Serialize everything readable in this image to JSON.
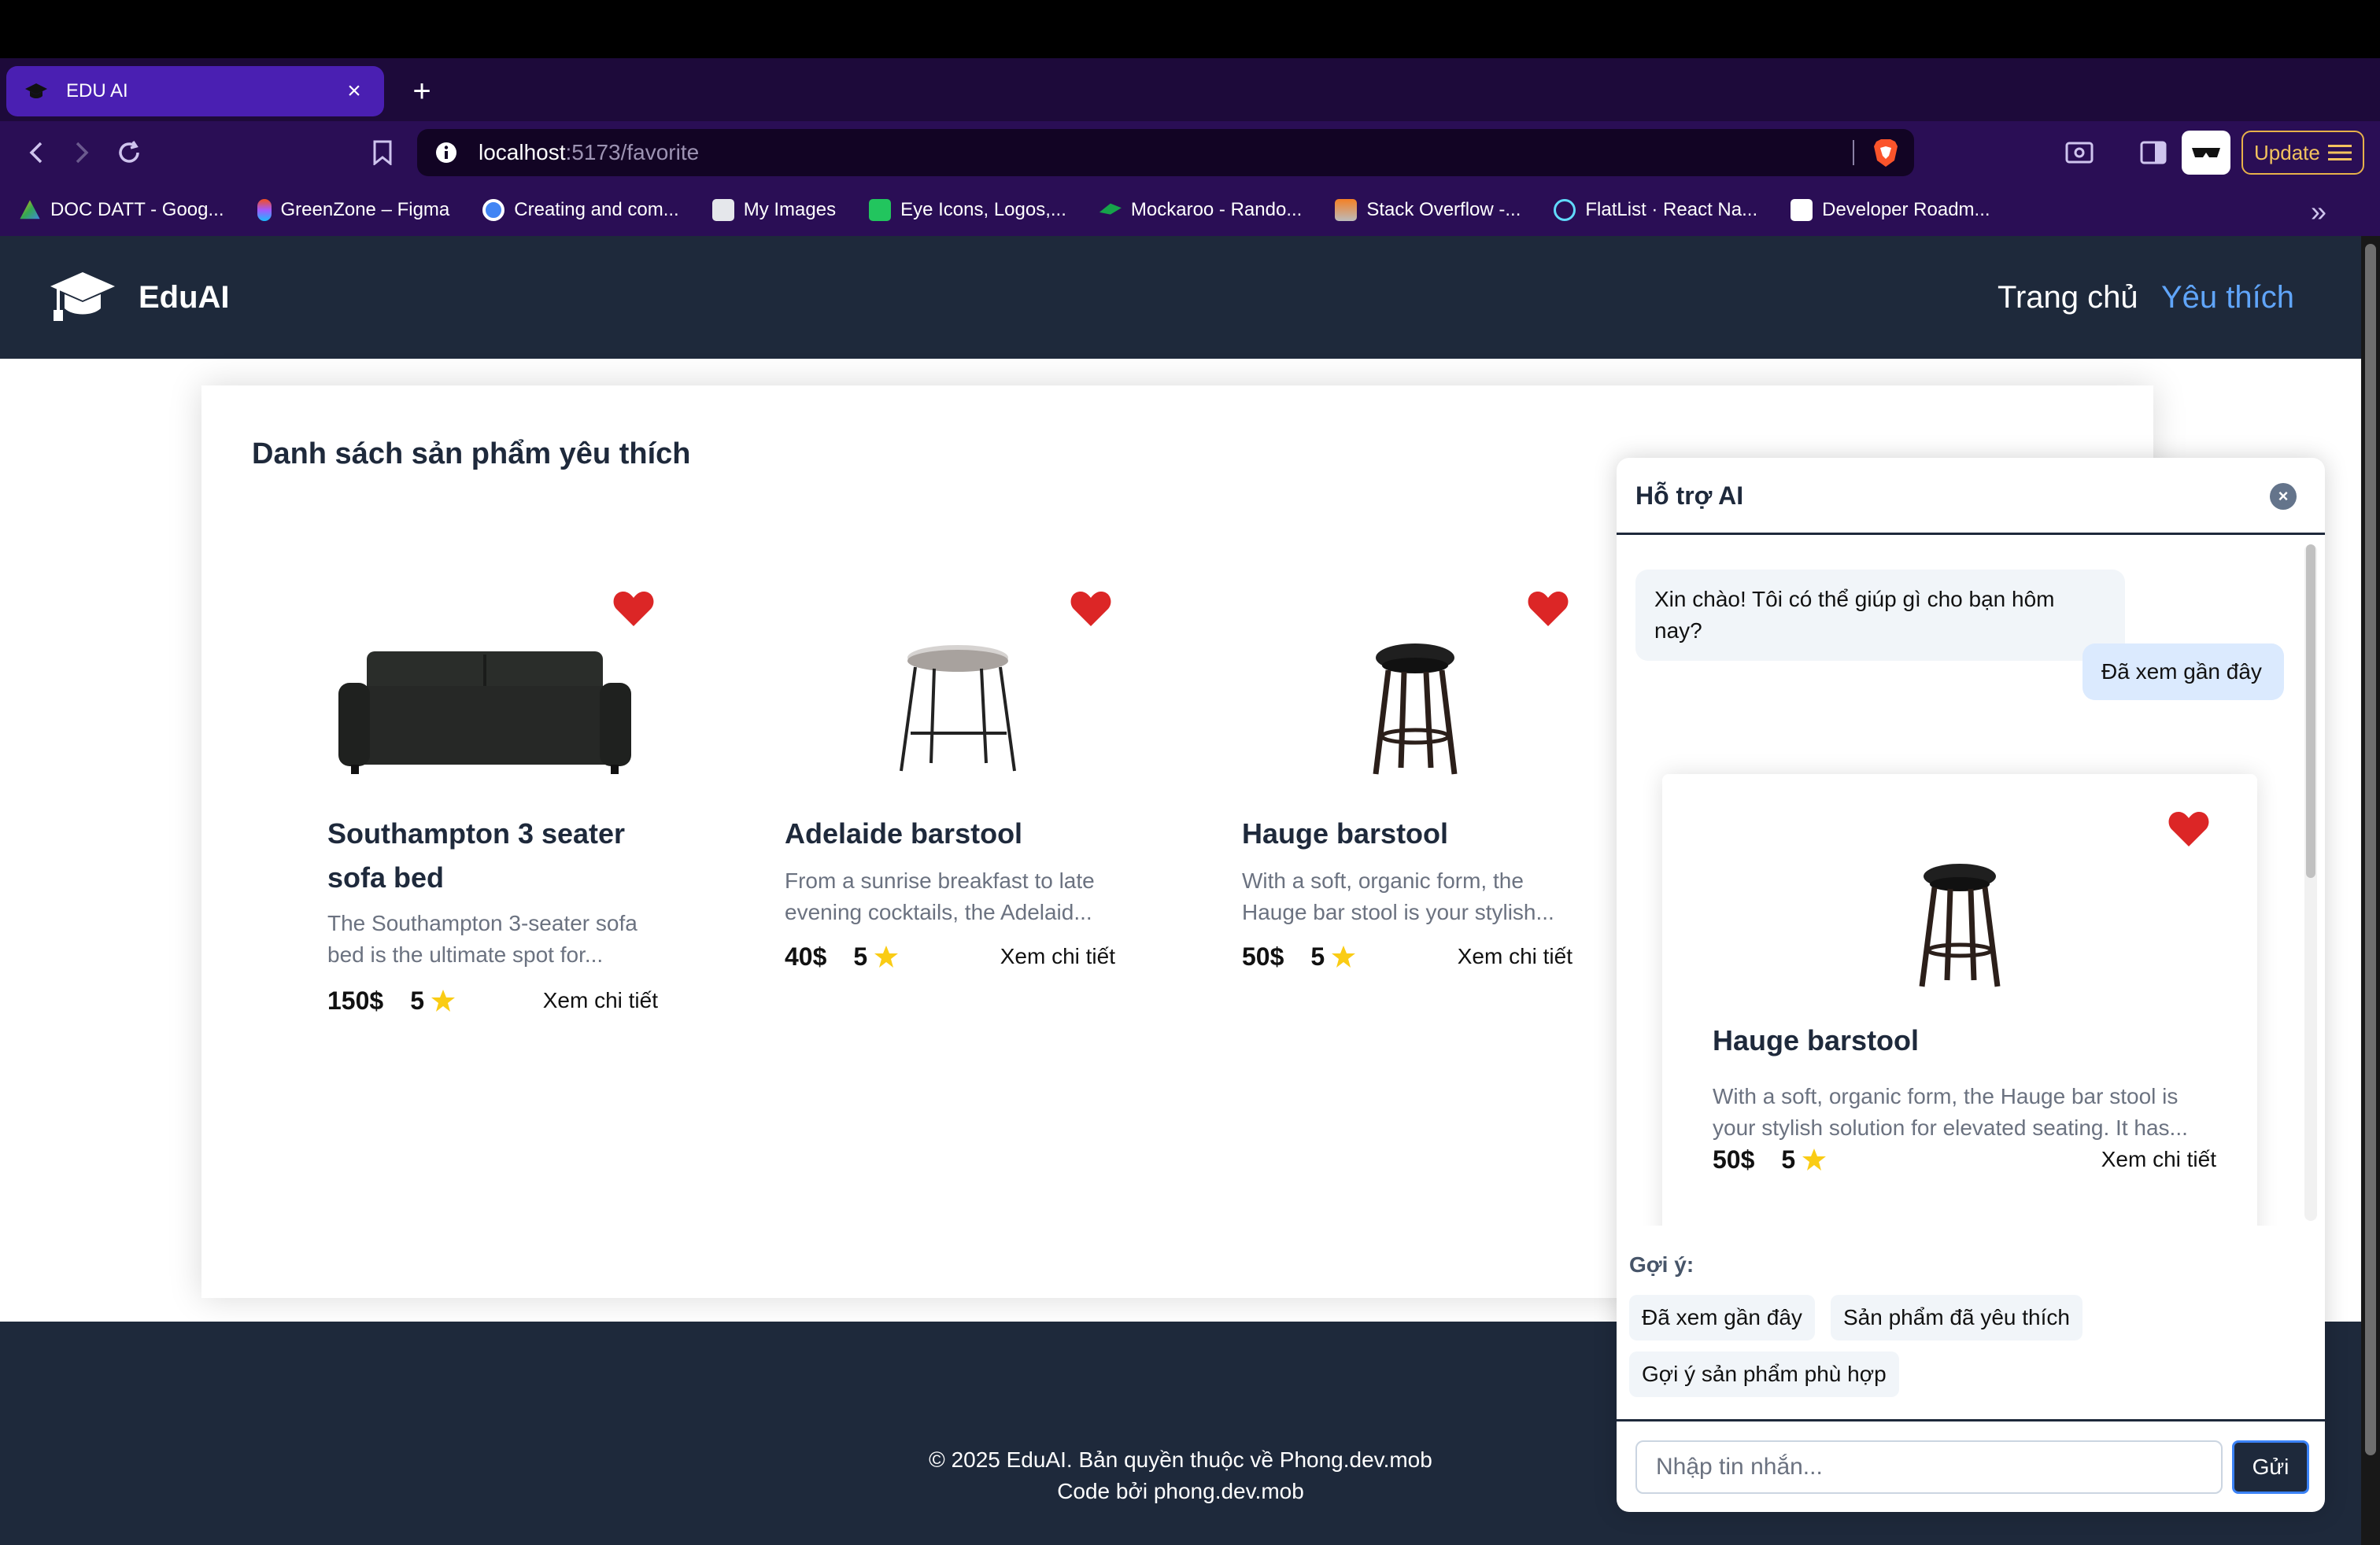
{
  "browser": {
    "tab_title": "EDU AI",
    "url_host": "localhost",
    "url_rest": ":5173/favorite",
    "update_label": "Update",
    "bookmarks": [
      {
        "label": "DOC DATT - Goog...",
        "icon": "google-drive-icon",
        "color": "#34a853"
      },
      {
        "label": "GreenZone – Figma",
        "icon": "figma-icon",
        "color": "#f24e1e"
      },
      {
        "label": "Creating and com...",
        "icon": "blue-circle-icon",
        "color": "#4285f4"
      },
      {
        "label": "My Images",
        "icon": "image-icon",
        "color": "#e5e7eb"
      },
      {
        "label": "Eye Icons, Logos,...",
        "icon": "eye-icon",
        "color": "#22c55e"
      },
      {
        "label": "Mockaroo - Rando...",
        "icon": "leaf-icon",
        "color": "#16a34a"
      },
      {
        "label": "Stack Overflow -...",
        "icon": "stackoverflow-icon",
        "color": "#f48024"
      },
      {
        "label": "FlatList · React Na...",
        "icon": "react-icon",
        "color": "#61dafb"
      },
      {
        "label": "Developer Roadm...",
        "icon": "roadmap-icon",
        "color": "#ffffff"
      }
    ]
  },
  "header": {
    "brand": "EduAI",
    "nav": {
      "home": "Trang chủ",
      "favorites": "Yêu thích"
    }
  },
  "main": {
    "title": "Danh sách sản phẩm yêu thích",
    "products": [
      {
        "name": "Southampton 3 seater sofa bed",
        "description": "The Southampton 3-seater sofa bed is the ultimate spot for...",
        "price": "150$",
        "rating": "5",
        "detail": "Xem chi tiết",
        "image": "sofa-icon"
      },
      {
        "name": "Adelaide barstool",
        "description": "From a sunrise breakfast to late evening cocktails, the Adelaid...",
        "price": "40$",
        "rating": "5",
        "detail": "Xem chi tiết",
        "image": "white-barstool-icon"
      },
      {
        "name": "Hauge barstool",
        "description": "With a soft, organic form, the Hauge bar stool is your stylish...",
        "price": "50$",
        "rating": "5",
        "detail": "Xem chi tiết",
        "image": "dark-barstool-icon"
      }
    ]
  },
  "footer": {
    "copyright": "© 2025 EduAI. Bản quyền thuộc về Phong.dev.mob",
    "credit": "Code bởi phong.dev.mob"
  },
  "chat": {
    "title": "Hỗ trợ AI",
    "bot_message": "Xin chào! Tôi có thể giúp gì cho bạn hôm nay?",
    "user_message": "Đã xem gần đây",
    "card": {
      "name": "Hauge barstool",
      "description": "With a soft, organic form, the Hauge bar stool is your stylish solution for elevated seating. It has...",
      "price": "50$",
      "rating": "5",
      "detail": "Xem chi tiết"
    },
    "suggest_label": "Gợi ý:",
    "suggestions": [
      "Đã xem gần đây",
      "Sản phẩm đã yêu thích",
      "Gợi ý sản phẩm phù hợp"
    ],
    "input_placeholder": "Nhập tin nhắn...",
    "send_label": "Gửi"
  },
  "colors": {
    "header_bg": "#1e293b",
    "accent": "#60a5fa",
    "heart": "#dc2626",
    "star": "#facc15",
    "browser_tab": "#4a1fb2"
  }
}
